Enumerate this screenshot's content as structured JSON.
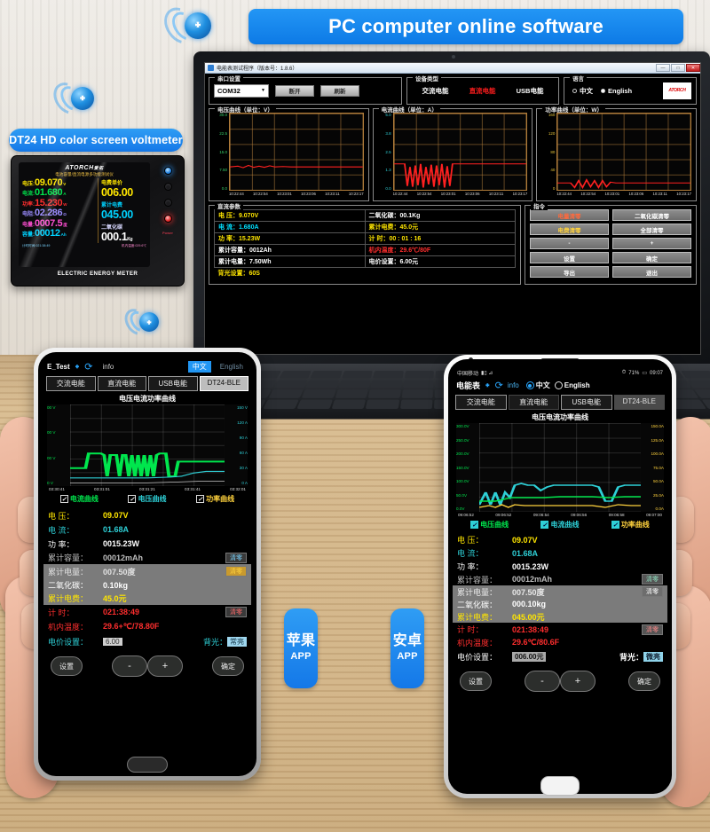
{
  "banner": {
    "title": "PC computer online software",
    "device_label": "DT24 HD color screen voltmeter"
  },
  "meter": {
    "brand": "ATORCH",
    "brand_cn": "爱拓",
    "subtitle": "电池容量/直流电源多功能测试仪",
    "caption": "ELECTRIC ENERGY METER",
    "left_rows": [
      {
        "label": "电压:",
        "value": "09.070",
        "unit": "V",
        "color": "#ffe600"
      },
      {
        "label": "电流:",
        "value": "01.680",
        "unit": "A",
        "color": "#00e64d"
      },
      {
        "label": "功率:",
        "value": "15.230",
        "unit": "W",
        "color": "#ff2e2e"
      },
      {
        "label": "电阻:",
        "value": "02.286",
        "unit": "Ω",
        "color": "#9b8cff"
      },
      {
        "label": "电量:",
        "value": "0007.5",
        "unit": "度",
        "color": "#ff4fd2"
      },
      {
        "label": "容量:",
        "value": "00012",
        "unit": "Ah",
        "color": "#00d2ff"
      }
    ],
    "right_rows": [
      {
        "label": "电费单价",
        "value": "006.00",
        "color": "#ffe600"
      },
      {
        "label": "累计电费",
        "value": "045.00",
        "color": "#00d2ff"
      },
      {
        "label": "二氧化碳",
        "value": "000.1",
        "unit": "Kg",
        "color": "#ffffff"
      }
    ],
    "foot_left": "计时时间:021:38:49",
    "foot_right": "机内温度:029.6℃",
    "power_led_label": "Power"
  },
  "pc": {
    "window_title": "电能表测试程序（版本号：1.8.6）",
    "minimize": "—",
    "maximize": "□",
    "close": "✕",
    "serial": {
      "legend": "串口设置",
      "port_value": "COM32",
      "open_button": "断开",
      "refresh_button": "刷新"
    },
    "device_type": {
      "legend": "设备类型",
      "options": [
        "交流电能",
        "直流电能",
        "USB电能"
      ],
      "selected": "直流电能",
      "selected_color": "#ff1d1d"
    },
    "language": {
      "legend": "语言",
      "options": [
        "中文",
        "English"
      ],
      "selected": "English",
      "logo": "ATORCH"
    },
    "charts": [
      {
        "legend": "电压曲线（单位：V）",
        "axis_color": "#35d06a",
        "y_ticks": [
          "30.0",
          "22.5",
          "15.0",
          "7.50",
          "0.0"
        ],
        "x_ticks": [
          "10:22:44",
          "10:22:54",
          "10:23:01",
          "10:23:06",
          "10:23:11",
          "10:23:17"
        ]
      },
      {
        "legend": "电流曲线（单位：A）",
        "axis_color": "#2ecfd6",
        "y_ticks": [
          "5.0",
          "3.8",
          "2.5",
          "1.3",
          "0.0"
        ],
        "x_ticks": [
          "10:22:44",
          "10:22:54",
          "10:23:01",
          "10:23:06",
          "10:23:11",
          "10:23:17"
        ]
      },
      {
        "legend": "功率曲线（单位：W）",
        "axis_color": "#e8c63a",
        "y_ticks": [
          "160",
          "120",
          "80",
          "40",
          "0"
        ],
        "x_ticks": [
          "10:22:44",
          "10:22:54",
          "10:23:01",
          "10:23:06",
          "10:23:11",
          "10:23:17"
        ]
      }
    ],
    "params": {
      "legend": "直流参数",
      "rows": [
        {
          "l_label": "电    压：",
          "l_value": "9.070V",
          "l_color": "#ffe600",
          "r_label": "二氧化碳：",
          "r_value": "00.1Kg",
          "r_color": "#ffffff"
        },
        {
          "l_label": "电    流：",
          "l_value": "1.680A",
          "l_color": "#00e0ff",
          "r_label": "累计电费：",
          "r_value": "45.0元",
          "r_color": "#ffe600"
        },
        {
          "l_label": "功    率：",
          "l_value": "15.23W",
          "l_color": "#ffe600",
          "r_label": "计    时：",
          "r_value": "00 : 01 : 16",
          "r_color": "#ffe600"
        },
        {
          "l_label": "累计容量：",
          "l_value": "0012Ah",
          "l_color": "#ffffff",
          "r_label": "机内温度：",
          "r_value": "29.6℃/80F",
          "r_color": "#ff2e2e"
        },
        {
          "l_label": "累计电量：",
          "l_value": "7.50Wh",
          "l_color": "#ffffff",
          "r_label": "电价设置：",
          "r_value": "6.00元",
          "r_color": "#ffffff"
        },
        {
          "l_label": "背光设置：",
          "l_value": "60S",
          "l_color": "#ffe600",
          "r_label": "",
          "r_value": "",
          "r_color": "#ffffff"
        }
      ]
    },
    "commands": {
      "legend": "指令",
      "buttons": [
        {
          "label": "电量清零",
          "color": "#ff6a3d"
        },
        {
          "label": "二氧化碳清零",
          "color": "#ffffff"
        },
        {
          "label": "电费清零",
          "color": "#ffd23d"
        },
        {
          "label": "全部清零",
          "color": "#ffffff"
        },
        {
          "label": "-",
          "color": "#ffffff"
        },
        {
          "label": "+",
          "color": "#ffffff"
        },
        {
          "label": "设置",
          "color": "#ffffff"
        },
        {
          "label": "确定",
          "color": "#ffffff"
        },
        {
          "label": "导出",
          "color": "#ffffff"
        },
        {
          "label": "退出",
          "color": "#ffffff"
        }
      ]
    }
  },
  "phone_left": {
    "platform_label": "苹果",
    "platform_sub": "APP",
    "header": {
      "title": "E_Test",
      "bluetooth_icon": "bluetooth-icon",
      "refresh_icon": "refresh-icon",
      "info": "info",
      "lang_cn": "中文",
      "lang_en": "English",
      "lang_selected": "中文"
    },
    "tabs": [
      "交流电能",
      "直流电能",
      "USB电能",
      "DT24-BLE"
    ],
    "tab_selected": "DT24-BLE",
    "chart_title": "电压电流功率曲线",
    "legend": [
      {
        "label": "电流曲线",
        "color": "#00e64d"
      },
      {
        "label": "电压曲线",
        "color": "#2ecfd6"
      },
      {
        "label": "功率曲线",
        "color": "#ffd23d"
      }
    ],
    "readings": [
      {
        "label": "电    压：",
        "value": "09.07V",
        "color": "#ffe600",
        "clear": ""
      },
      {
        "label": "电    流：",
        "value": "01.68A",
        "color": "#2ecfd6",
        "clear": ""
      },
      {
        "label": "功    率：",
        "value": "0015.23W",
        "color": "#ffffff",
        "clear": ""
      },
      {
        "label": "累计容量：",
        "value": "00012mAh",
        "color": "#bdbdbd",
        "clear": "清零"
      },
      {
        "label": "累计电量：",
        "value": "007.50度",
        "color": "#e0e0e0",
        "clear": "清零",
        "highlight": true
      },
      {
        "label": "二氧化碳：",
        "value": "0.10kg",
        "color": "#ffffff",
        "clear": "",
        "highlight": true
      },
      {
        "label": "累计电费：",
        "value": "45.0元",
        "color": "#ffe600",
        "clear": "",
        "highlight": true
      },
      {
        "label": "计    时：",
        "value": "021:38:49",
        "color": "#ff2e2e",
        "clear": "清零"
      },
      {
        "label": "机内温度：",
        "value": "29.6+℃/78.80F",
        "color": "#ff2e2e",
        "clear": ""
      }
    ],
    "price_label": "电价设置：",
    "price_value": "6.00",
    "backlight_label": "背光：",
    "backlight_value": "常亮",
    "buttons": {
      "settings": "设置",
      "minus": "-",
      "plus": "+",
      "confirm": "确定"
    }
  },
  "phone_right": {
    "platform_label": "安卓",
    "platform_sub": "APP",
    "statusbar": {
      "carrier": "中国移动",
      "battery": "71%",
      "time": "09:07"
    },
    "header": {
      "title": "电能表",
      "bluetooth_icon": "bluetooth-icon",
      "refresh_icon": "refresh-icon",
      "info": "info",
      "lang_cn": "中文",
      "lang_en": "English",
      "lang_selected": "中文"
    },
    "tabs": [
      "交流电能",
      "直流电能",
      "USB电能",
      "DT24-BLE"
    ],
    "tab_selected": "DT24-BLE",
    "chart_title": "电压电流功率曲线",
    "legend": [
      {
        "label": "电压曲线",
        "color": "#00e64d"
      },
      {
        "label": "电流曲线",
        "color": "#2ecfd6"
      },
      {
        "label": "功率曲线",
        "color": "#ffd23d"
      }
    ],
    "readings": [
      {
        "label": "电    压：",
        "value": "09.07V",
        "color": "#ffe600"
      },
      {
        "label": "电    流：",
        "value": "01.68A",
        "color": "#2ecfd6"
      },
      {
        "label": "功    率：",
        "value": "0015.23W",
        "color": "#ffffff"
      },
      {
        "label": "累计容量：",
        "value": "00012mAh",
        "color": "#bdbdbd",
        "clear": "清零"
      },
      {
        "label": "累计电量：",
        "value": "007.50度",
        "color": "#e0e0e0",
        "clear": "清零",
        "highlight": true
      },
      {
        "label": "二氧化碳：",
        "value": "000.10kg",
        "color": "#ffffff",
        "highlight": true
      },
      {
        "label": "累计电费：",
        "value": "045.00元",
        "color": "#ffe600",
        "highlight": true
      },
      {
        "label": "计    时：",
        "value": "021:38:49",
        "color": "#ff2e2e",
        "clear": "清零"
      },
      {
        "label": "机内温度：",
        "value": "29.6℃/80.6F",
        "color": "#ff2e2e"
      }
    ],
    "price_label": "电价设置：",
    "price_value": "006.00元",
    "backlight_label": "背光：",
    "backlight_value": "微亮",
    "buttons": {
      "settings": "设置",
      "minus": "-",
      "plus": "+",
      "confirm": "确定"
    }
  },
  "chart_data": [
    {
      "type": "line",
      "title": "电压曲线（单位：V）",
      "xlabel": "",
      "ylabel": "V",
      "ylim": [
        0,
        30
      ],
      "y_ticks": [
        0,
        7.5,
        15,
        22.5,
        30
      ],
      "x": [
        "10:22:44",
        "10:22:54",
        "10:23:01",
        "10:23:06",
        "10:23:11",
        "10:23:17"
      ],
      "series": [
        {
          "name": "电压",
          "color": "#ff2020",
          "values": [
            9.0,
            9.1,
            8.9,
            9.1,
            9.0,
            9.07,
            9.05,
            9.07,
            9.07,
            9.07,
            9.07,
            9.07
          ]
        }
      ],
      "grid": true,
      "legend": "none"
    },
    {
      "type": "line",
      "title": "电流曲线（单位：A）",
      "xlabel": "",
      "ylabel": "A",
      "ylim": [
        0,
        5
      ],
      "y_ticks": [
        0,
        1.3,
        2.5,
        3.8,
        5.0
      ],
      "x": [
        "10:22:44",
        "10:22:54",
        "10:23:01",
        "10:23:06",
        "10:23:11",
        "10:23:17"
      ],
      "series": [
        {
          "name": "电流",
          "color": "#ff2020",
          "values": [
            1.68,
            1.68,
            0.2,
            1.9,
            0.3,
            1.9,
            0.2,
            1.85,
            0.25,
            1.9,
            1.68,
            1.68
          ]
        }
      ],
      "grid": true,
      "legend": "none"
    },
    {
      "type": "line",
      "title": "功率曲线（单位：W）",
      "xlabel": "",
      "ylabel": "W",
      "ylim": [
        0,
        160
      ],
      "y_ticks": [
        0,
        40,
        80,
        120,
        160
      ],
      "x": [
        "10:22:44",
        "10:22:54",
        "10:23:01",
        "10:23:06",
        "10:23:11",
        "10:23:17"
      ],
      "series": [
        {
          "name": "功率",
          "color": "#ff2020",
          "values": [
            15,
            15,
            2,
            20,
            3,
            22,
            2,
            20,
            3,
            18,
            15,
            15
          ]
        }
      ],
      "grid": true,
      "legend": "none"
    },
    {
      "type": "line",
      "title": "电压电流功率曲线",
      "subtitle": "苹果APP",
      "xlabel": "",
      "ylabel": "V",
      "ylim": [
        0,
        300
      ],
      "y_ticks_left": [
        "00 V",
        "00 V",
        "00 V",
        "0 V"
      ],
      "y_ticks_right": [
        "150 V",
        "120 A",
        "90 A",
        "60 A",
        "30 A",
        "0 A"
      ],
      "x": [
        "03:30:41",
        "03:31:01",
        "03:31:21",
        "03:31:41",
        "03:32:01"
      ],
      "series": [
        {
          "name": "电流曲线",
          "color": "#00e64d",
          "values": [
            30,
            30,
            55,
            55,
            20,
            55,
            20,
            55,
            20,
            55,
            20,
            55,
            55,
            20,
            48,
            48
          ]
        },
        {
          "name": "电压曲线",
          "color": "#2ecfd6",
          "values": [
            12,
            12,
            13,
            13,
            13,
            13,
            13,
            13,
            13,
            13,
            13,
            13,
            13,
            13,
            22,
            22
          ]
        },
        {
          "name": "功率曲线",
          "color": "#ffd23d",
          "values": [
            5,
            5,
            5,
            5,
            5,
            5,
            5,
            5,
            5,
            5,
            5,
            5,
            5,
            5,
            6,
            6
          ]
        }
      ],
      "grid": true,
      "legend": "bottom"
    },
    {
      "type": "line",
      "title": "电压电流功率曲线",
      "subtitle": "安卓APP",
      "xlabel": "",
      "ylabel": "V",
      "ylim": [
        0,
        300
      ],
      "y_ticks_left": [
        "300.0V",
        "250.0V",
        "200.0V",
        "150.0V",
        "100.0V",
        "50.0V",
        "0.0V"
      ],
      "y_ticks_right": [
        "150.0A",
        "125.0A",
        "100.0A",
        "75.0A",
        "50.0A",
        "25.0A",
        "0.0A"
      ],
      "x": [
        "09:06:52",
        "09:06:52",
        "09:06:54",
        "09:06:56",
        "09:06:58",
        "09:07:00"
      ],
      "series": [
        {
          "name": "电压曲线",
          "color": "#00e64d",
          "values": [
            25,
            25,
            28,
            28,
            28,
            28,
            30,
            30,
            30,
            30,
            28,
            32,
            30,
            30,
            30,
            30
          ]
        },
        {
          "name": "电流曲线",
          "color": "#2ecfd6",
          "values": [
            20,
            52,
            20,
            52,
            30,
            55,
            30,
            55,
            52,
            52,
            52,
            52,
            50,
            30,
            52,
            52
          ]
        },
        {
          "name": "功率曲线",
          "color": "#ffd23d",
          "values": [
            8,
            12,
            8,
            14,
            10,
            14,
            12,
            12,
            12,
            12,
            12,
            12,
            12,
            10,
            12,
            12
          ]
        }
      ],
      "grid": true,
      "legend": "bottom"
    }
  ],
  "labels": {
    "apple_app": "苹果",
    "android_app": "安卓",
    "app_suffix": "APP"
  }
}
